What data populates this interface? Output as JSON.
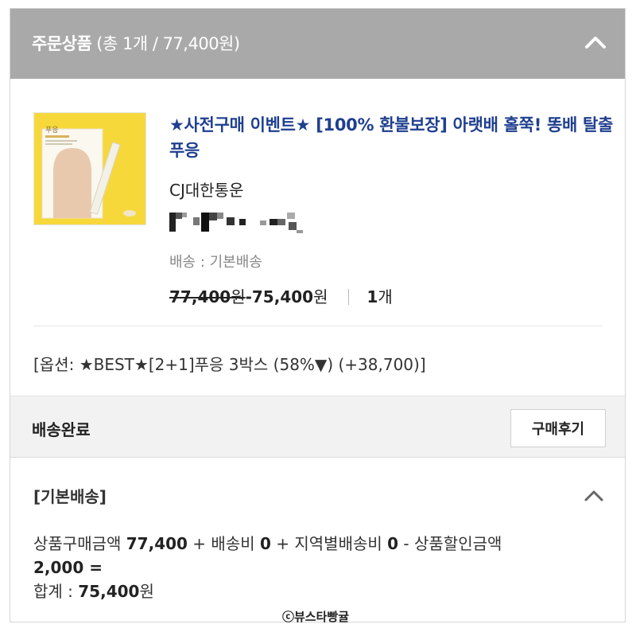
{
  "header": {
    "title": "주문상품",
    "summary": "(총 1개 / 77,400원)",
    "collapse_icon": "chevron-up-icon"
  },
  "product": {
    "name": "★사전구매 이벤트★ [100% 환불보장] 아랫배 홀쭉! 똥배 탈출 푸응",
    "carrier": "CJ대한통운",
    "shipping_label": "배송 : 기본배송",
    "original_price_num": "77,400",
    "original_price_unit": "원",
    "sale_price_num": "-75,400",
    "sale_price_unit": "원",
    "quantity_num": "1",
    "quantity_unit": "개",
    "thumbnail_brand": "푸응"
  },
  "option": {
    "text": "[옵션: ★BEST★[2+1]푸응 3박스 (58%▼) (+38,700)]"
  },
  "status": {
    "label": "배송완료",
    "review_button": "구매후기"
  },
  "delivery": {
    "title": "[기본배송]",
    "collapse_icon": "chevron-up-icon",
    "line1_a": "상품구매금액 ",
    "line1_b": "77,400",
    "line1_c": " + 배송비 ",
    "line1_d": "0",
    "line1_e": " + 지역별배송비 ",
    "line1_f": "0",
    "line1_g": " - 상품할인금액",
    "line2": "2,000 =",
    "total_label": "합계 : ",
    "total_num": "75,400",
    "total_unit": "원"
  },
  "watermark": "ⓒ뷰스타빵귤",
  "colors": {
    "header_bg": "#a9a9a9",
    "title": "#1f3f8f",
    "thumb_bg": "#f7d83a"
  }
}
